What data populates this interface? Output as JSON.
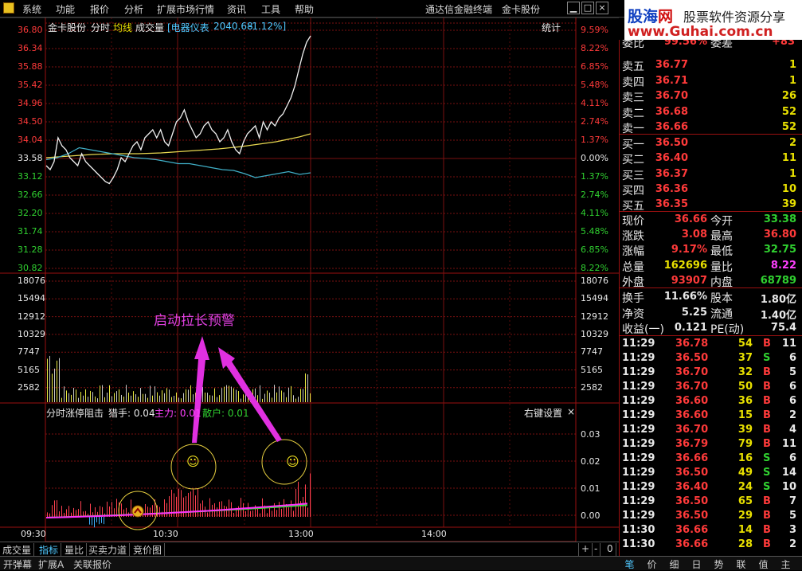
{
  "menu": {
    "items": [
      "系统",
      "功能",
      "报价",
      "分析",
      "扩展市场行情",
      "资讯",
      "工具",
      "帮助"
    ],
    "broker": "通达信金融终端",
    "stock": "金卡股份"
  },
  "logo": {
    "brand_a": "股海",
    "brand_b": "网",
    "tagline": "股票软件资源分享",
    "url": "www.Guhai.com.cn"
  },
  "header": {
    "name": "金卡股份",
    "mode": "分时",
    "avg": "均线",
    "vol": "成交量",
    "index_name": "[电器仪表",
    "index_val": "2040.68",
    "index_chg": "-1.12%]",
    "stats": "统计"
  },
  "price_axis": {
    "left": [
      "36.80",
      "36.34",
      "35.88",
      "35.42",
      "34.96",
      "34.50",
      "34.04",
      "33.58",
      "33.12",
      "32.66",
      "32.20",
      "31.74",
      "31.28",
      "30.82"
    ],
    "right": [
      "9.59%",
      "8.22%",
      "6.85%",
      "5.48%",
      "4.11%",
      "2.74%",
      "1.37%",
      "0.00%",
      "1.37%",
      "2.74%",
      "4.11%",
      "5.48%",
      "6.85%",
      "8.22%"
    ],
    "colors": [
      "red",
      "red",
      "red",
      "red",
      "red",
      "red",
      "red",
      "white",
      "green",
      "green",
      "green",
      "green",
      "green",
      "green"
    ]
  },
  "vol_axis": [
    "18076",
    "15494",
    "12912",
    "10329",
    "7747",
    "5165",
    "2582"
  ],
  "indicator": {
    "title": "分时涨停阻击",
    "hunter": "猎手: 0.04",
    "main": "主力: 0.01",
    "retail": "散户: 0.01",
    "settings": "右键设置",
    "close": "×",
    "axis": [
      "0.03",
      "0.02",
      "0.01",
      "0.00"
    ]
  },
  "time_axis": [
    "09:30",
    "10:30",
    "13:00",
    "14:00"
  ],
  "annotation": {
    "text": "启动拉长预警",
    "smile1": "☺",
    "smile2": "☺"
  },
  "chart_data": {
    "type": "line",
    "series": [
      {
        "name": "价格",
        "values": [
          33.4,
          33.3,
          33.5,
          34.1,
          33.9,
          33.8,
          33.6,
          33.5,
          33.4,
          33.7,
          33.5,
          33.4,
          33.3,
          33.2,
          33.1,
          33.0,
          32.95,
          33.1,
          33.3,
          33.6,
          33.5,
          33.7,
          33.9,
          34.0,
          33.8,
          34.1,
          34.2,
          34.3,
          34.1,
          34.3,
          34.0,
          33.9,
          34.2,
          34.5,
          34.6,
          34.8,
          34.5,
          34.3,
          34.1,
          34.2,
          34.4,
          34.5,
          34.3,
          34.2,
          34.0,
          34.1,
          34.3,
          34.0,
          33.8,
          33.7,
          34.0,
          34.2,
          34.3,
          34.4,
          34.1,
          34.5,
          34.3,
          34.5,
          34.4,
          34.6,
          34.7,
          34.9,
          35.1,
          35.4,
          35.8,
          36.2,
          36.5,
          36.66
        ]
      },
      {
        "name": "均线",
        "values": [
          33.6,
          33.62,
          33.64,
          33.66,
          33.68,
          33.69,
          33.7,
          33.7,
          33.7,
          33.71,
          33.72,
          33.74,
          33.76,
          33.78,
          33.8,
          33.82,
          33.85,
          33.88,
          33.92,
          33.96,
          34.0,
          34.06,
          34.12,
          34.2
        ]
      },
      {
        "name": "指数",
        "values": [
          33.55,
          33.6,
          33.7,
          33.85,
          33.8,
          33.75,
          33.7,
          33.65,
          33.6,
          33.58,
          33.55,
          33.5,
          33.45,
          33.45,
          33.4,
          33.35,
          33.3,
          33.28,
          33.2,
          33.1,
          33.15,
          33.2,
          33.25,
          33.18,
          33.22
        ]
      }
    ],
    "ylim": [
      30.82,
      36.8
    ]
  },
  "quote": {
    "top": {
      "l1": "委比",
      "v1": "99.56%",
      "l2": "委差",
      "v2": "+83"
    },
    "sell": [
      {
        "l": "卖五",
        "p": "36.77",
        "v": "1"
      },
      {
        "l": "卖四",
        "p": "36.71",
        "v": "1"
      },
      {
        "l": "卖三",
        "p": "36.70",
        "v": "26"
      },
      {
        "l": "卖二",
        "p": "36.68",
        "v": "52"
      },
      {
        "l": "卖一",
        "p": "36.66",
        "v": "52"
      }
    ],
    "buy": [
      {
        "l": "买一",
        "p": "36.50",
        "v": "2"
      },
      {
        "l": "买二",
        "p": "36.40",
        "v": "11"
      },
      {
        "l": "买三",
        "p": "36.37",
        "v": "1"
      },
      {
        "l": "买四",
        "p": "36.36",
        "v": "10"
      },
      {
        "l": "买五",
        "p": "36.35",
        "v": "39"
      }
    ],
    "stats": [
      {
        "l1": "现价",
        "v1": "36.66",
        "c1": "red",
        "l2": "今开",
        "v2": "33.38",
        "c2": "green"
      },
      {
        "l1": "涨跌",
        "v1": "3.08",
        "c1": "red",
        "l2": "最高",
        "v2": "36.80",
        "c2": "red"
      },
      {
        "l1": "涨幅",
        "v1": "9.17%",
        "c1": "red",
        "l2": "最低",
        "v2": "32.75",
        "c2": "green"
      },
      {
        "l1": "总量",
        "v1": "162696",
        "c1": "yellow",
        "l2": "量比",
        "v2": "8.22",
        "c2": "magenta"
      },
      {
        "l1": "外盘",
        "v1": "93907",
        "c1": "red",
        "l2": "内盘",
        "v2": "68789",
        "c2": "green"
      }
    ],
    "stats2": [
      {
        "l1": "换手",
        "v1": "11.66%",
        "l2": "股本",
        "v2": "1.80亿"
      },
      {
        "l1": "净资",
        "v1": "5.25",
        "l2": "流通",
        "v2": "1.40亿"
      },
      {
        "l1": "收益(一)",
        "v1": "0.121",
        "l2": "PE(动)",
        "v2": "75.4"
      }
    ]
  },
  "ticks": [
    {
      "t": "11:29",
      "p": "36.78",
      "v": "54",
      "d": "B",
      "n": "11"
    },
    {
      "t": "11:29",
      "p": "36.50",
      "v": "37",
      "d": "S",
      "n": "6"
    },
    {
      "t": "11:29",
      "p": "36.70",
      "v": "32",
      "d": "B",
      "n": "5"
    },
    {
      "t": "11:29",
      "p": "36.70",
      "v": "50",
      "d": "B",
      "n": "6"
    },
    {
      "t": "11:29",
      "p": "36.60",
      "v": "36",
      "d": "B",
      "n": "6"
    },
    {
      "t": "11:29",
      "p": "36.60",
      "v": "15",
      "d": "B",
      "n": "2"
    },
    {
      "t": "11:29",
      "p": "36.70",
      "v": "39",
      "d": "B",
      "n": "4"
    },
    {
      "t": "11:29",
      "p": "36.79",
      "v": "79",
      "d": "B",
      "n": "11"
    },
    {
      "t": "11:29",
      "p": "36.66",
      "v": "16",
      "d": "S",
      "n": "6"
    },
    {
      "t": "11:29",
      "p": "36.50",
      "v": "49",
      "d": "S",
      "n": "14"
    },
    {
      "t": "11:29",
      "p": "36.40",
      "v": "24",
      "d": "S",
      "n": "10"
    },
    {
      "t": "11:29",
      "p": "36.50",
      "v": "65",
      "d": "B",
      "n": "7"
    },
    {
      "t": "11:29",
      "p": "36.50",
      "v": "29",
      "d": "B",
      "n": "5"
    },
    {
      "t": "11:30",
      "p": "36.66",
      "v": "14",
      "d": "B",
      "n": "3"
    },
    {
      "t": "11:30",
      "p": "36.66",
      "v": "28",
      "d": "B",
      "n": "2"
    }
  ],
  "bottom_tabs": [
    "成交量",
    "指标",
    "量比",
    "买卖力道",
    "竞价图"
  ],
  "bottom_ctrl": [
    "+",
    "-",
    "0"
  ],
  "status": {
    "tabs": [
      "开弹幕",
      "扩展A",
      "关联报价"
    ],
    "right_tabs": [
      "笔",
      "价",
      "细",
      "日",
      "势",
      "联",
      "值",
      "主"
    ]
  }
}
